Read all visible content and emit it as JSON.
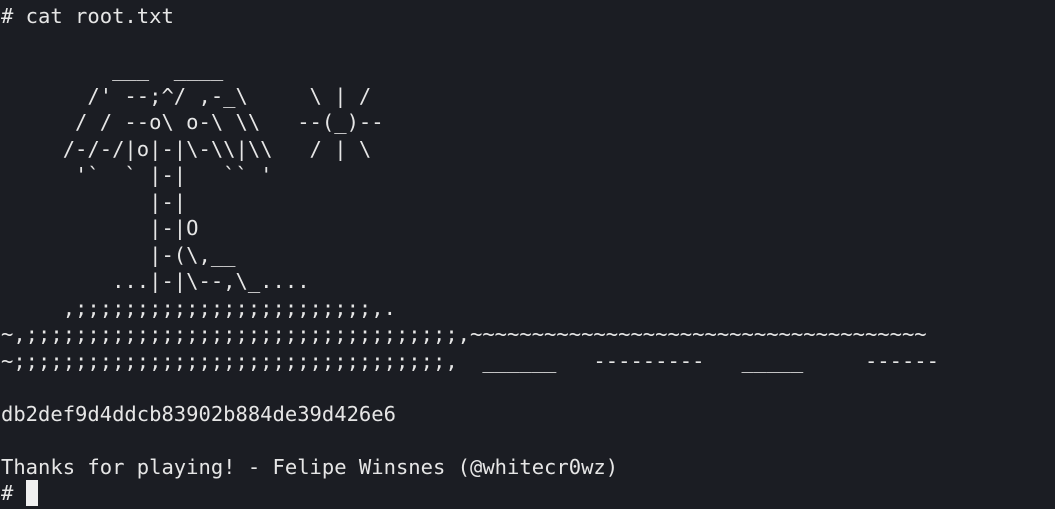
{
  "terminal": {
    "command_line": "# cat root.txt",
    "art_lines": [
      "         ___  ____",
      "       /' --;^/ ,-_\\     \\ | /",
      "      / / --o\\ o-\\ \\\\   --(_)--",
      "     /-/-/|o|-|\\-\\\\|\\\\   / | \\",
      "      '`  ` |-|   `` '",
      "            |-|",
      "            |-|O",
      "            |-(\\,__",
      "         ...|-|\\--,\\_....",
      "     ,;;;;;;;;;;;;;;;;;;;;;;;;,.",
      "~,;;;;;;;;;;;;;;;;;;;;;;;;;;;;;;;;;;;,~~~~~~~~~~~~~~~~~~~~~~~~~~~~~~~~~~~~~",
      "~;;;;;;;;;;;;;;;;;;;;;;;;;;;;;;;;;;;,  ______   ---------   _____     ------"
    ],
    "blank_line": "",
    "flag": "db2def9d4ddcb83902b884de39d426e6",
    "thanks": "Thanks for playing! - Felipe Winsnes (@whitecr0wz)",
    "prompt": "# "
  }
}
